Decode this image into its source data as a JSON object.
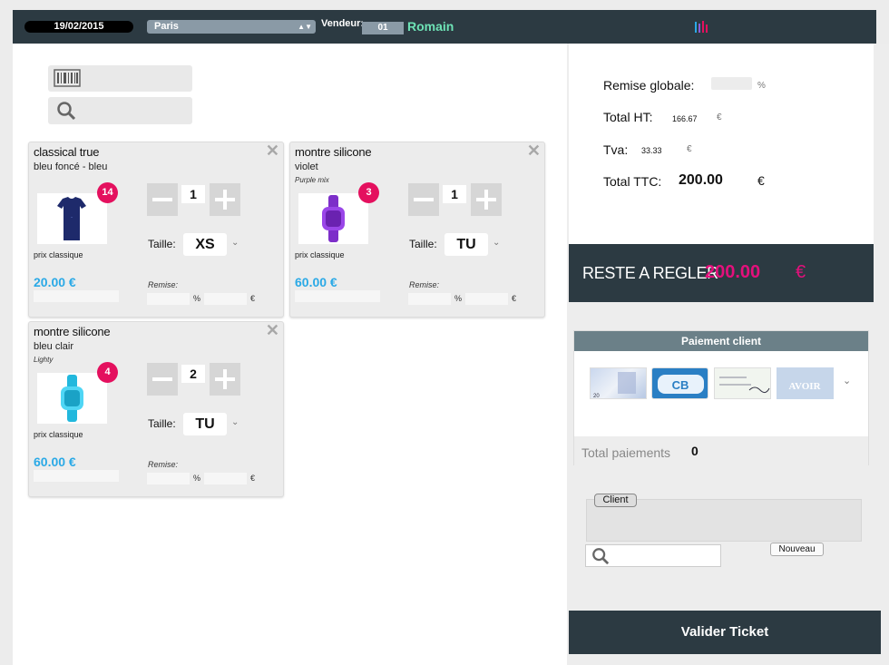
{
  "topbar": {
    "date": "19/02/2015",
    "city": "Paris",
    "vendeur_label": "Vendeur:",
    "vendeur_id": "01",
    "vendeur_name": "Romain",
    "brand_colors": [
      "#e4105e",
      "#2aa9e6",
      "#6ee3b6",
      "#8a5cd6"
    ]
  },
  "tools": {
    "scan_icon": "barcode-icon",
    "search_icon": "search-icon"
  },
  "cart": {
    "items": [
      {
        "name": "classical true",
        "color": "bleu foncé - bleu",
        "variant": "",
        "count": "14",
        "quantity": "1",
        "size_label": "Taille:",
        "size": "XS",
        "price_type": "prix classique",
        "price": "20.00 €",
        "remise_label": "Remise:",
        "pct": "%",
        "eur": "€",
        "image": "tshirt-image"
      },
      {
        "name": "montre silicone",
        "color": "violet",
        "variant": "Purple mix",
        "count": "3",
        "quantity": "1",
        "size_label": "Taille:",
        "size": "TU",
        "price_type": "prix classique",
        "price": "60.00 €",
        "remise_label": "Remise:",
        "pct": "%",
        "eur": "€",
        "image": "watch-purple-image"
      },
      {
        "name": "montre silicone",
        "color": "bleu clair",
        "variant": "Lighty",
        "count": "4",
        "quantity": "2",
        "size_label": "Taille:",
        "size": "TU",
        "price_type": "prix classique",
        "price": "60.00 €",
        "remise_label": "Remise:",
        "pct": "%",
        "eur": "€",
        "image": "watch-cyan-image"
      }
    ]
  },
  "totals": {
    "remise_label": "Remise globale:",
    "remise_unit": "%",
    "ht_label": "Total HT:",
    "ht_value": "166.67",
    "tva_label": "Tva:",
    "tva_value": "33.33",
    "ttc_label": "Total TTC:",
    "ttc_value": "200.00",
    "euro": "€"
  },
  "reste": {
    "label": "RESTE A REGLER",
    "amount": "200.00",
    "euro": "€"
  },
  "payment": {
    "header": "Paiement client",
    "options": [
      "cash-icon",
      "card-icon",
      "cheque-icon",
      "avoir-icon"
    ],
    "card_text": "CB",
    "avoir_text": "AVOIR",
    "total_label": "Total paiements",
    "total_value": "0"
  },
  "client": {
    "button": "Client",
    "new_button": "Nouveau"
  },
  "actions": {
    "validate": "Valider Ticket"
  }
}
